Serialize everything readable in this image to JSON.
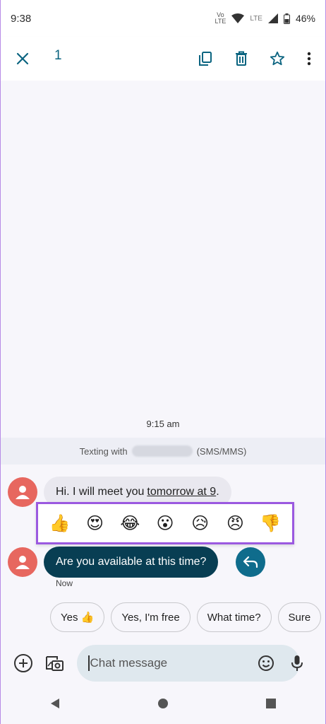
{
  "status": {
    "time": "9:38",
    "volte_top": "Vo",
    "volte_bottom": "LTE",
    "lte": "LTE",
    "battery": "46%"
  },
  "actionbar": {
    "selected_count": "1"
  },
  "conversation": {
    "time_label": "9:15 am",
    "texting_prefix": "Texting with",
    "texting_suffix": "(SMS/MMS)",
    "incoming_text": "Hi. I will meet you",
    "incoming_link": "tomorrow at 9",
    "incoming_end": ".",
    "reactions": [
      "👍",
      "😍",
      "😂",
      "😮",
      "😥",
      "😠",
      "👎"
    ],
    "outgoing_text": "Are you available at this time?",
    "outgoing_status": "Now"
  },
  "suggestions": [
    "Yes 👍",
    "Yes, I'm free",
    "What time?",
    "Sure"
  ],
  "compose": {
    "placeholder": "Chat message"
  },
  "colors": {
    "accent": "#0b6480",
    "outgoing_bubble": "#083e53",
    "avatar": "#e7675f",
    "highlight": "#9b59e0"
  }
}
